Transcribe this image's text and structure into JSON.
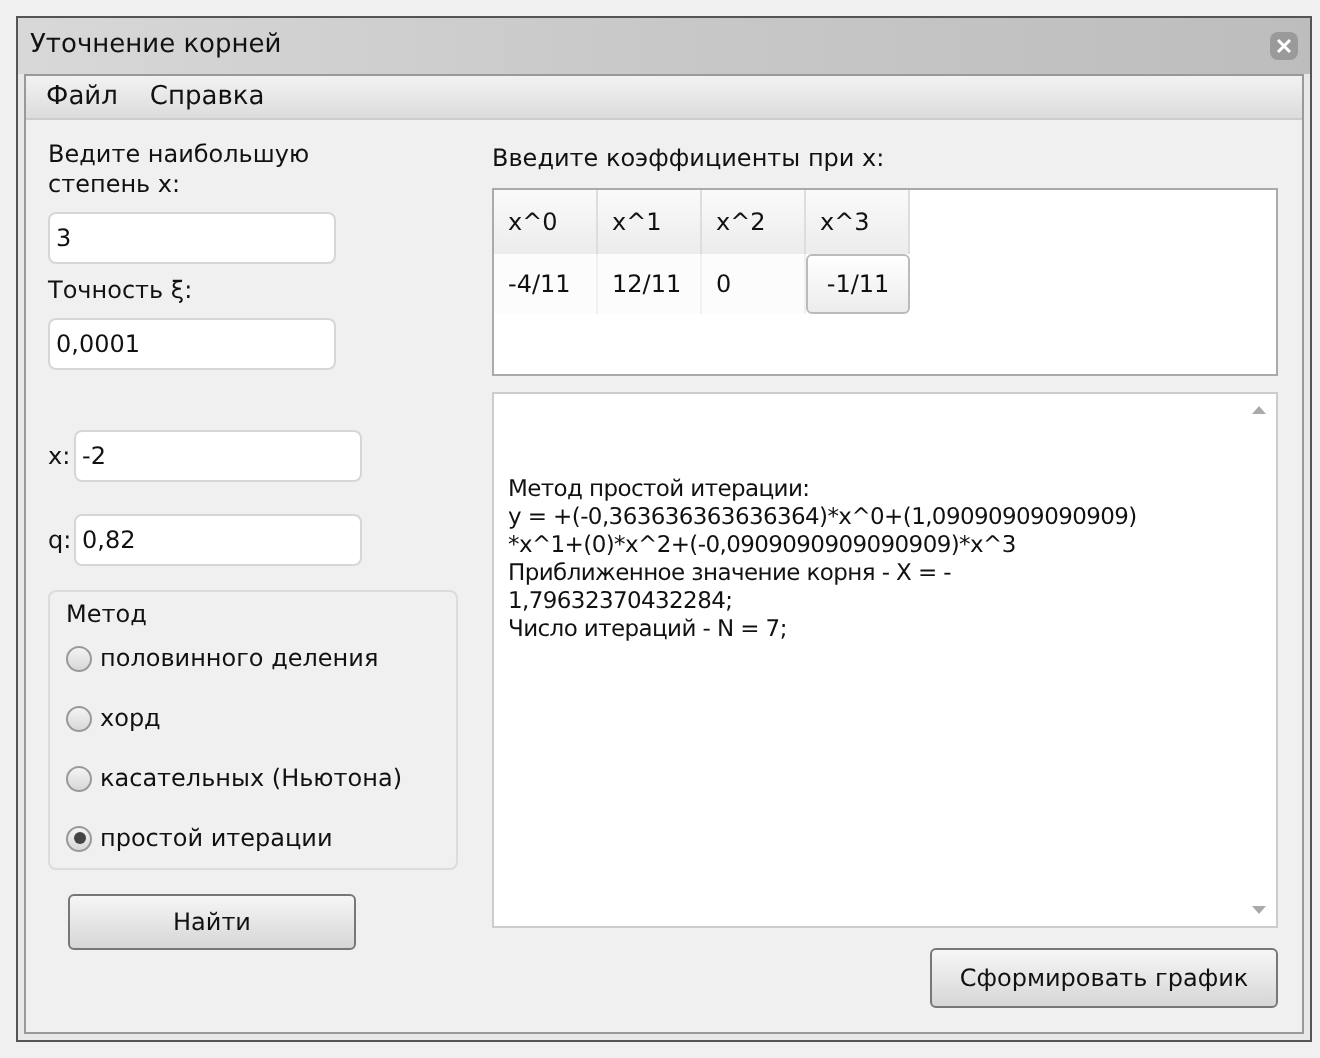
{
  "window": {
    "title": "Уточнение корней"
  },
  "menu": [
    "Файл",
    "Справка"
  ],
  "degree": {
    "label": "Ведите наибольшую степень x:",
    "value": "3"
  },
  "precision": {
    "label": "Точность ξ:",
    "value": "0,0001"
  },
  "x_field": {
    "label": "x:",
    "value": "-2"
  },
  "q_field": {
    "label": "q:",
    "value": "0,82"
  },
  "method": {
    "title": "Метод",
    "options": [
      {
        "label": "половинного деления",
        "selected": false
      },
      {
        "label": "хорд",
        "selected": false
      },
      {
        "label": "касательных (Ньютона)",
        "selected": false
      },
      {
        "label": "простой итерации",
        "selected": true
      }
    ]
  },
  "coefficients": {
    "label": "Введите коэффициенты при x:",
    "columns": [
      "x^0",
      "x^1",
      "x^2",
      "x^3"
    ],
    "cells": [
      {
        "text": "-4/11",
        "selected": false
      },
      {
        "text": "12/11",
        "selected": false
      },
      {
        "text": "0",
        "selected": false
      },
      {
        "text": "-1/11",
        "selected": true
      }
    ]
  },
  "result": {
    "lines": [
      "Метод простой итерации:",
      "y = +(-0,363636363636364)*x^0+(1,09090909090909)",
      "*x^1+(0)*x^2+(-0,0909090909090909)*x^3",
      "Приближенное значение корня - X = -",
      "1,79632370432284;",
      "Число итераций - N = 7;"
    ]
  },
  "buttons": {
    "find": "Найти",
    "plot": "Сформировать график"
  }
}
